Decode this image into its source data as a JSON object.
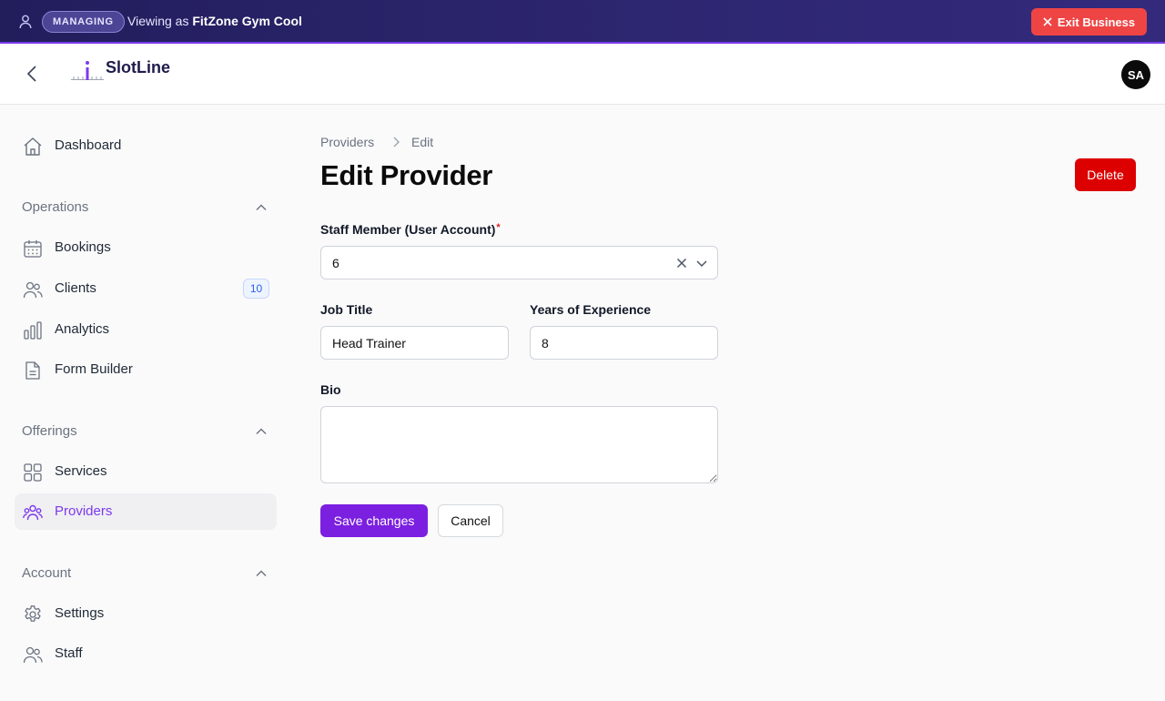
{
  "banner": {
    "badge": "MANAGING",
    "viewing_prefix": "Viewing as ",
    "business_name": "FitZone Gym Cool",
    "exit_label": "Exit Business"
  },
  "header": {
    "brand": "SlotLine",
    "avatar_initials": "SA"
  },
  "sidebar": {
    "dashboard": "Dashboard",
    "sections": [
      {
        "label": "Operations",
        "items": [
          {
            "label": "Bookings",
            "icon": "calendar-icon"
          },
          {
            "label": "Clients",
            "icon": "users-icon",
            "count": "10"
          },
          {
            "label": "Analytics",
            "icon": "bar-chart-icon"
          },
          {
            "label": "Form Builder",
            "icon": "file-text-icon"
          }
        ]
      },
      {
        "label": "Offerings",
        "items": [
          {
            "label": "Services",
            "icon": "grid-icon"
          },
          {
            "label": "Providers",
            "icon": "team-icon",
            "active": true
          }
        ]
      },
      {
        "label": "Account",
        "items": [
          {
            "label": "Settings",
            "icon": "gear-icon"
          },
          {
            "label": "Staff",
            "icon": "users-icon"
          }
        ]
      }
    ]
  },
  "breadcrumb": {
    "parent": "Providers",
    "current": "Edit"
  },
  "page": {
    "title": "Edit Provider",
    "delete_label": "Delete"
  },
  "form": {
    "staff_label": "Staff Member (User Account)",
    "staff_required": "*",
    "staff_value": "6",
    "job_title_label": "Job Title",
    "job_title_value": "Head Trainer",
    "years_label": "Years of Experience",
    "years_value": "8",
    "bio_label": "Bio",
    "bio_value": "",
    "save_label": "Save changes",
    "cancel_label": "Cancel"
  },
  "colors": {
    "accent": "#7c3aed",
    "banner_bg": "#2d2670",
    "exit_red": "#ef4444",
    "delete_red": "#dc0000"
  }
}
